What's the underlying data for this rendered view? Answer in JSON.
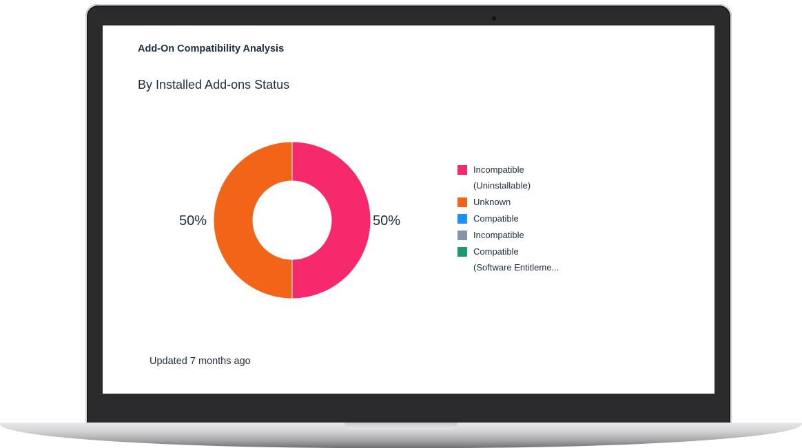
{
  "card": {
    "title": "Add-On Compatibility Analysis",
    "subtitle": "By Installed Add-ons Status",
    "footer": "Updated 7 months ago"
  },
  "chart_data": {
    "type": "pie",
    "title": "By Installed Add-ons Status",
    "donut": true,
    "slices": [
      {
        "label": "Incompatible (Uninstallable)",
        "value": 50,
        "display": "50%",
        "color": "#f5296b"
      },
      {
        "label": "Unknown",
        "value": 50,
        "display": "50%",
        "color": "#f26418"
      }
    ],
    "legend": [
      {
        "label": "Incompatible\n(Uninstallable)",
        "color": "#f5296b"
      },
      {
        "label": "Unknown",
        "color": "#f26418"
      },
      {
        "label": "Compatible",
        "color": "#1b90ff"
      },
      {
        "label": "Incompatible",
        "color": "#8396a8"
      },
      {
        "label": "Compatible\n(Software Entitleme...",
        "color": "#1d9a6c"
      }
    ],
    "legend_position": "right"
  }
}
